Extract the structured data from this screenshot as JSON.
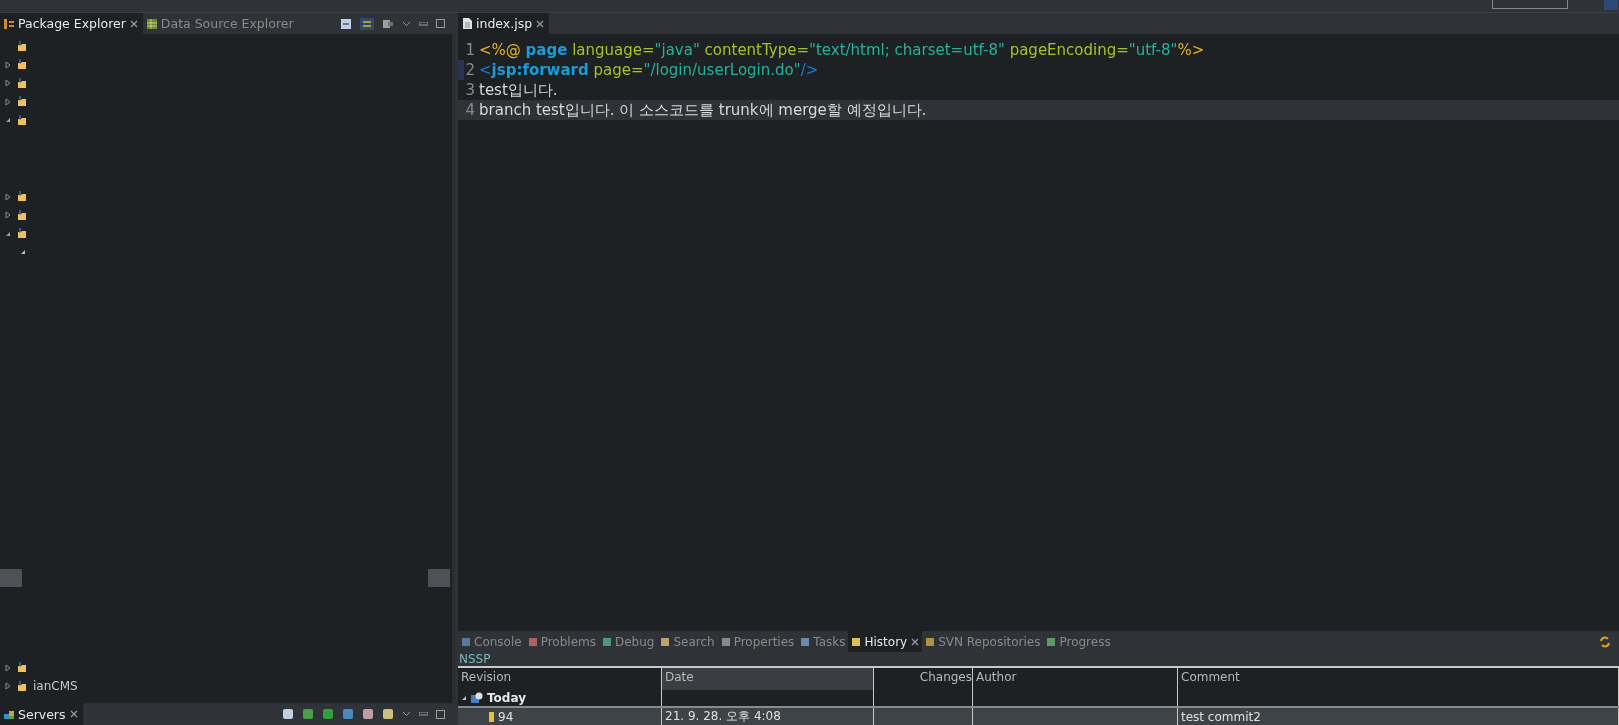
{
  "left_panel": {
    "tabs": [
      {
        "label": "Package Explorer",
        "selected": true
      },
      {
        "label": "Data Source Explorer",
        "selected": false
      }
    ],
    "tree_groups": [
      [
        {
          "kind": "leaf"
        },
        {
          "kind": "branch",
          "expanded": false
        },
        {
          "kind": "branch",
          "expanded": false
        },
        {
          "kind": "branch",
          "expanded": false
        },
        {
          "kind": "branch",
          "expanded": true
        }
      ],
      [
        {
          "kind": "branch",
          "expanded": false
        },
        {
          "kind": "branch",
          "expanded": false
        },
        {
          "kind": "branch",
          "expanded": true,
          "children": [
            {
              "expanded": true
            }
          ]
        }
      ],
      [
        {
          "kind": "branch",
          "expanded": false
        },
        {
          "kind": "branch",
          "expanded": false,
          "label": "ianCMS"
        }
      ]
    ]
  },
  "servers_tab": {
    "label": "Servers",
    "selected": true
  },
  "editor": {
    "tab": {
      "label": "index.jsp",
      "selected": true
    },
    "lines": [
      {
        "number": "1",
        "current": false,
        "tokens": [
          {
            "kind": "directive",
            "text": "<%@ "
          },
          {
            "kind": "keyword",
            "text": "page"
          },
          {
            "kind": "attr",
            "text": " language="
          },
          {
            "kind": "value",
            "text": "\"java\""
          },
          {
            "kind": "attr",
            "text": " contentType="
          },
          {
            "kind": "value",
            "text": "\"text/html; charset=utf-8\""
          },
          {
            "kind": "attr",
            "text": " pageEncoding="
          },
          {
            "kind": "value",
            "text": "\"utf-8\""
          },
          {
            "kind": "directive",
            "text": "%>"
          }
        ]
      },
      {
        "number": "2",
        "current": false,
        "tokens": [
          {
            "kind": "tag",
            "text": "<"
          },
          {
            "kind": "keyword",
            "text": "jsp:forward"
          },
          {
            "kind": "attr",
            "text": " page="
          },
          {
            "kind": "value",
            "text": "\"/login/userLogin.do\""
          },
          {
            "kind": "tag",
            "text": "/>"
          }
        ]
      },
      {
        "number": "3",
        "current": false,
        "tokens": [
          {
            "kind": "plain",
            "text": "test입니다."
          }
        ]
      },
      {
        "number": "4",
        "current": true,
        "tokens": [
          {
            "kind": "plain",
            "text": "branch test입니다. 이 소스코드를 trunk에 merge할 예정입니다."
          }
        ]
      }
    ]
  },
  "bottom_panel": {
    "tabs": [
      {
        "label": "Console",
        "selected": false
      },
      {
        "label": "Problems",
        "selected": false
      },
      {
        "label": "Debug",
        "selected": false
      },
      {
        "label": "Search",
        "selected": false
      },
      {
        "label": "Properties",
        "selected": false
      },
      {
        "label": "Tasks",
        "selected": false
      },
      {
        "label": "History",
        "selected": true
      },
      {
        "label": "SVN Repositories",
        "selected": false
      },
      {
        "label": "Progress",
        "selected": false
      }
    ],
    "resource": "NSSP",
    "history": {
      "columns": [
        {
          "label": "Revision",
          "sorted": false
        },
        {
          "label": "Date",
          "sorted": true
        },
        {
          "label": "Changes",
          "sorted": false
        },
        {
          "label": "Author",
          "sorted": false
        },
        {
          "label": "Comment",
          "sorted": false
        }
      ],
      "group": {
        "label": "Today",
        "expanded": true
      },
      "rows": [
        {
          "revision": "94",
          "date": "21. 9. 28. 오후 4:08",
          "changes": "",
          "author": "",
          "comment": "test commit2",
          "selected": true
        }
      ]
    }
  }
}
